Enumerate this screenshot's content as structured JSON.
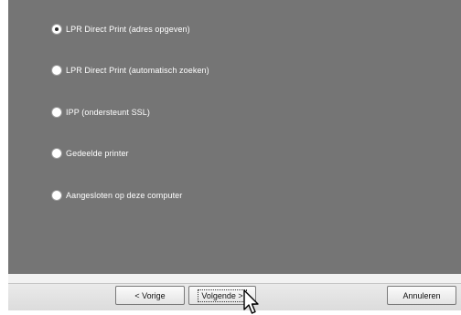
{
  "options": [
    {
      "label": "LPR Direct Print (adres opgeven)",
      "checked": true
    },
    {
      "label": "LPR Direct Print (automatisch zoeken)",
      "checked": false
    },
    {
      "label": "IPP (ondersteunt SSL)",
      "checked": false
    },
    {
      "label": "Gedeelde printer",
      "checked": false
    },
    {
      "label": "Aangesloten op deze computer",
      "checked": false
    }
  ],
  "buttons": {
    "prev": {
      "arrow": "<",
      "label": "Vorige"
    },
    "next": {
      "label": "Volgende",
      "arrow": ">"
    },
    "cancel": {
      "label": "Annuleren"
    }
  },
  "cursor_icon": "mouse-pointer-icon"
}
